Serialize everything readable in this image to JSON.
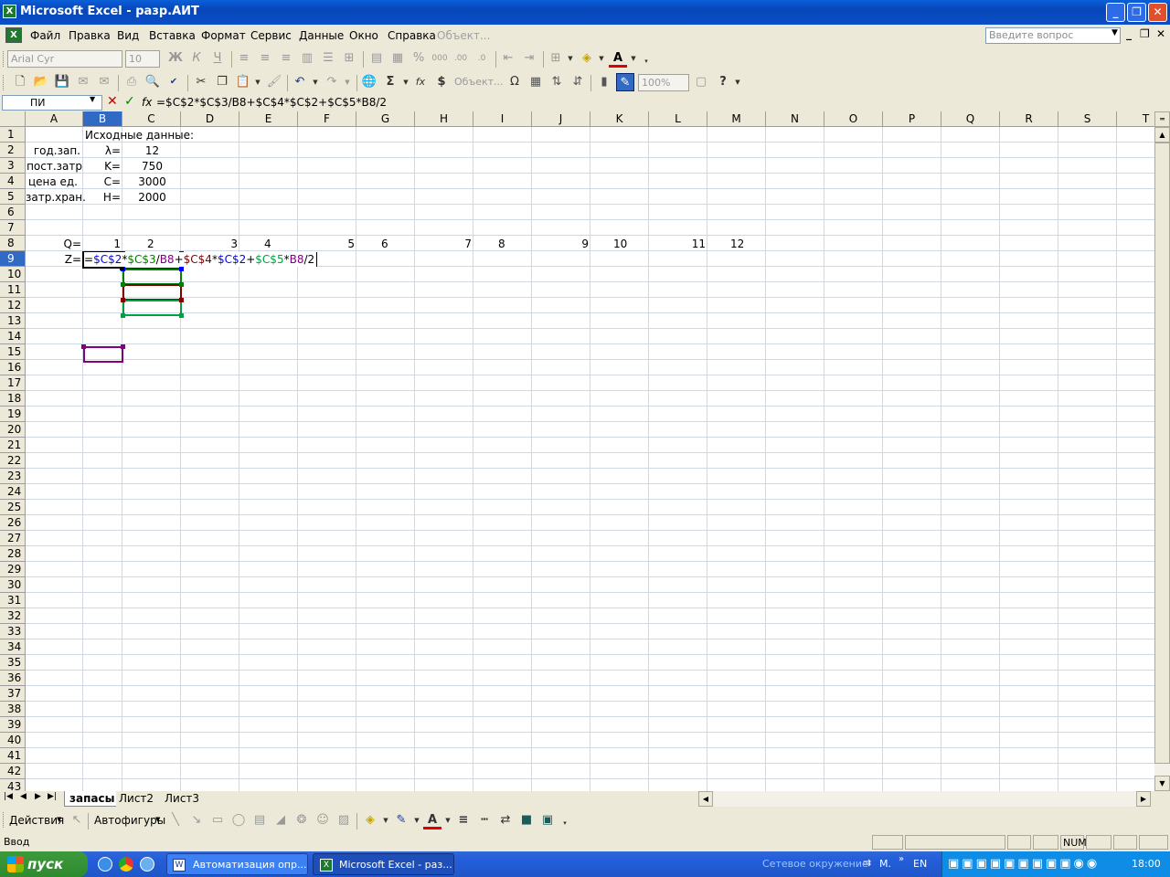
{
  "window": {
    "title": "Microsoft Excel - разр.АИТ",
    "minimize": "_",
    "restore": "❐",
    "close": "✕"
  },
  "menu": {
    "items": [
      "Файл",
      "Правка",
      "Вид",
      "Вставка",
      "Формат",
      "Сервис",
      "Данные",
      "Окно",
      "Справка",
      "Объект..."
    ],
    "help_placeholder": "Введите вопрос"
  },
  "toolbar": {
    "font": "Arial Cyr",
    "size": "10",
    "zoom": "100%",
    "object_label": "Объект..."
  },
  "formula_bar": {
    "name_box": "ПИ",
    "fx": "fx",
    "formula": "=$C$2*$C$3/B8+$C$4*$C$2+$C$5*B8/2"
  },
  "columns": [
    "A",
    "B",
    "C",
    "D",
    "E",
    "F",
    "G",
    "H",
    "I",
    "J",
    "K",
    "L",
    "M",
    "N",
    "O",
    "P",
    "Q",
    "R",
    "S",
    "T"
  ],
  "rows": [
    "1",
    "2",
    "3",
    "4",
    "5",
    "6",
    "7",
    "8",
    "9",
    "10",
    "11",
    "12",
    "13",
    "14",
    "15",
    "16",
    "17",
    "18",
    "19",
    "20",
    "21",
    "22",
    "23",
    "24",
    "25",
    "26",
    "27",
    "28",
    "29",
    "30",
    "31",
    "32",
    "33",
    "34",
    "35",
    "36",
    "37",
    "38",
    "39",
    "40",
    "41",
    "42",
    "43"
  ],
  "cells": {
    "B1": "Исходные данные:",
    "A2": "год.зап.",
    "B2": "λ=",
    "C2": "12",
    "A3": "пост.затр",
    "B3": "K=",
    "C3": "750",
    "A4": "цена ед.",
    "B4": "C=",
    "C4": "3000",
    "A5": "затр.хран.",
    "B5": "H=",
    "C5": "2000",
    "A8": "Q=",
    "B8": "1",
    "C8": "2",
    "D8": "3",
    "E8": "4",
    "F8": "5",
    "G8": "6",
    "H8": "7",
    "I8": "8",
    "J8": "9",
    "K8": "10",
    "L8": "11",
    "M8": "12",
    "A9": "Z="
  },
  "edit_formula": [
    {
      "t": "=",
      "c": "#000000"
    },
    {
      "t": "$C$2",
      "c": "#0000ff"
    },
    {
      "t": "*",
      "c": "#000000"
    },
    {
      "t": "$C$3",
      "c": "#008000"
    },
    {
      "t": "/",
      "c": "#000000"
    },
    {
      "t": "B8",
      "c": "#800080"
    },
    {
      "t": "+",
      "c": "#000000"
    },
    {
      "t": "$C$4",
      "c": "#800000"
    },
    {
      "t": "*",
      "c": "#000000"
    },
    {
      "t": "$C$2",
      "c": "#0000ff"
    },
    {
      "t": "+",
      "c": "#000000"
    },
    {
      "t": "$C$5",
      "c": "#00a040"
    },
    {
      "t": "*",
      "c": "#000000"
    },
    {
      "t": "B8",
      "c": "#800080"
    },
    {
      "t": "/2",
      "c": "#000000"
    }
  ],
  "sheets": {
    "active": "запасы",
    "others": [
      "Лист2",
      "Лист3"
    ]
  },
  "draw_toolbar": {
    "actions": "Действия",
    "autoshapes": "Автофигуры"
  },
  "status": {
    "mode": "Ввод",
    "num": "NUM"
  },
  "taskbar": {
    "start": "пуск",
    "tasks": [
      "Автоматизация опр...",
      "Microsoft Excel - раз..."
    ],
    "network": "Сетевое окружение",
    "network_short": "M.",
    "lang": "EN",
    "clock": "18:00"
  }
}
